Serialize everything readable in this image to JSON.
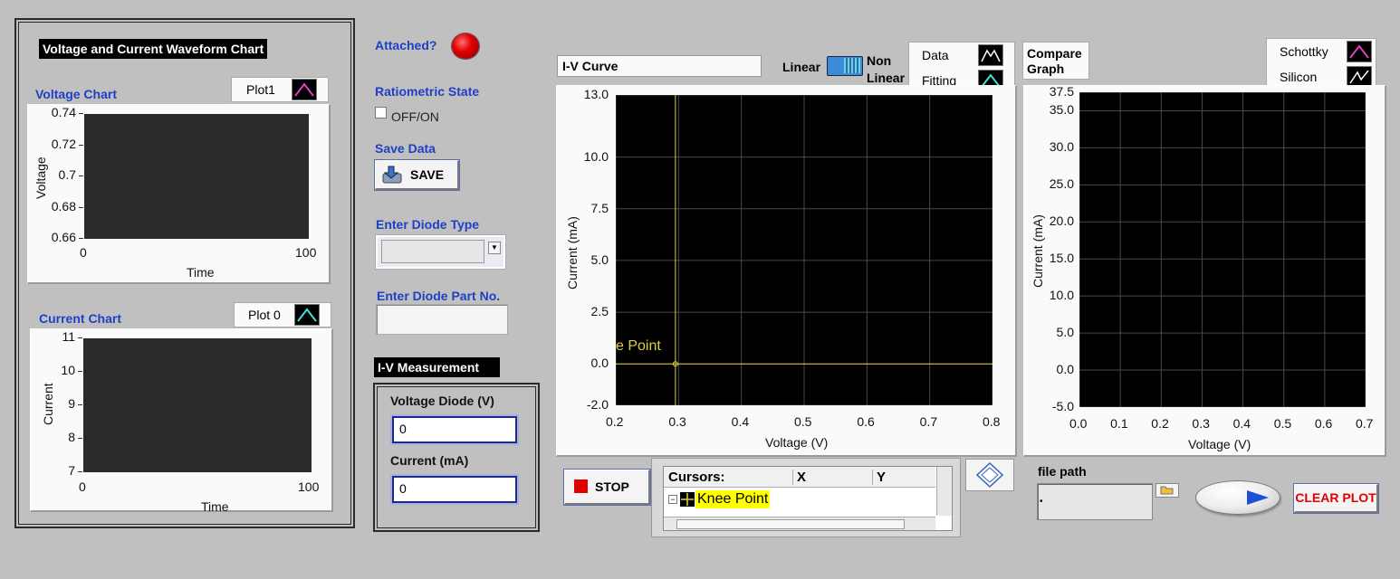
{
  "left_panel": {
    "title": "Voltage and Current Waveform Chart",
    "voltage_chart": {
      "label": "Voltage Chart",
      "legend": "Plot1",
      "legend_color": "#e040c0",
      "y_ticks": [
        "0.74",
        "0.72",
        "0.7",
        "0.68",
        "0.66"
      ],
      "x_ticks": [
        "0",
        "100"
      ],
      "ylabel": "Voltage",
      "xlabel": "Time"
    },
    "current_chart": {
      "label": "Current Chart",
      "legend": "Plot 0",
      "legend_color": "#40e0d0",
      "y_ticks": [
        "11",
        "10",
        "9",
        "8",
        "7"
      ],
      "x_ticks": [
        "0",
        "100"
      ],
      "ylabel": "Current",
      "xlabel": "Time"
    }
  },
  "controls": {
    "attached_label": "Attached?",
    "led_color": "#d40000",
    "ratiometric_label": "Ratiometric State",
    "ratiometric_option": "OFF/ON",
    "save_label": "Save Data",
    "save_button": "SAVE",
    "diode_type_label": "Enter Diode Type",
    "diode_type_value": "",
    "part_no_label": "Enter Diode Part No.",
    "part_no_value": "",
    "iv_title": "I-V Measurement",
    "voltage_diode_label": "Voltage Diode (V)",
    "voltage_diode_value": "0",
    "current_label": "Current (mA)",
    "current_value": "0"
  },
  "iv_curve": {
    "title": "I-V Curve",
    "toggle_left": "Linear",
    "toggle_right_1": "Non",
    "toggle_right_2": "Linear",
    "legend": [
      {
        "name": "Data",
        "color": "#ffffff"
      },
      {
        "name": "Fitting",
        "color": "#40e0d0"
      }
    ],
    "y_ticks": [
      "13.0",
      "10.0",
      "7.5",
      "5.0",
      "2.5",
      "0.0",
      "-2.0"
    ],
    "x_ticks": [
      "0.2",
      "0.3",
      "0.4",
      "0.5",
      "0.6",
      "0.7",
      "0.8"
    ],
    "ylabel": "Current (mA)",
    "xlabel": "Voltage (V)",
    "cursor_label": "e Point",
    "stop_button": "STOP",
    "cursors": {
      "header": "Cursors:",
      "col_x": "X",
      "col_y": "Y",
      "row_name": "Knee Point"
    }
  },
  "compare_graph": {
    "title_1": "Compare",
    "title_2": "Graph",
    "legend": [
      {
        "name": "Schottky",
        "color": "#e040c0"
      },
      {
        "name": "Silicon",
        "color": "#ffffff"
      }
    ],
    "y_ticks": [
      "37.5",
      "35.0",
      "30.0",
      "25.0",
      "20.0",
      "15.0",
      "10.0",
      "5.0",
      "0.0",
      "-5.0"
    ],
    "x_ticks": [
      "0.0",
      "0.1",
      "0.2",
      "0.3",
      "0.4",
      "0.5",
      "0.6",
      "0.7"
    ],
    "ylabel": "Current (mA)",
    "xlabel": "Voltage (V)",
    "file_path_label": "file path",
    "file_path_value": "",
    "clear_button": "CLEAR PLOT"
  }
}
